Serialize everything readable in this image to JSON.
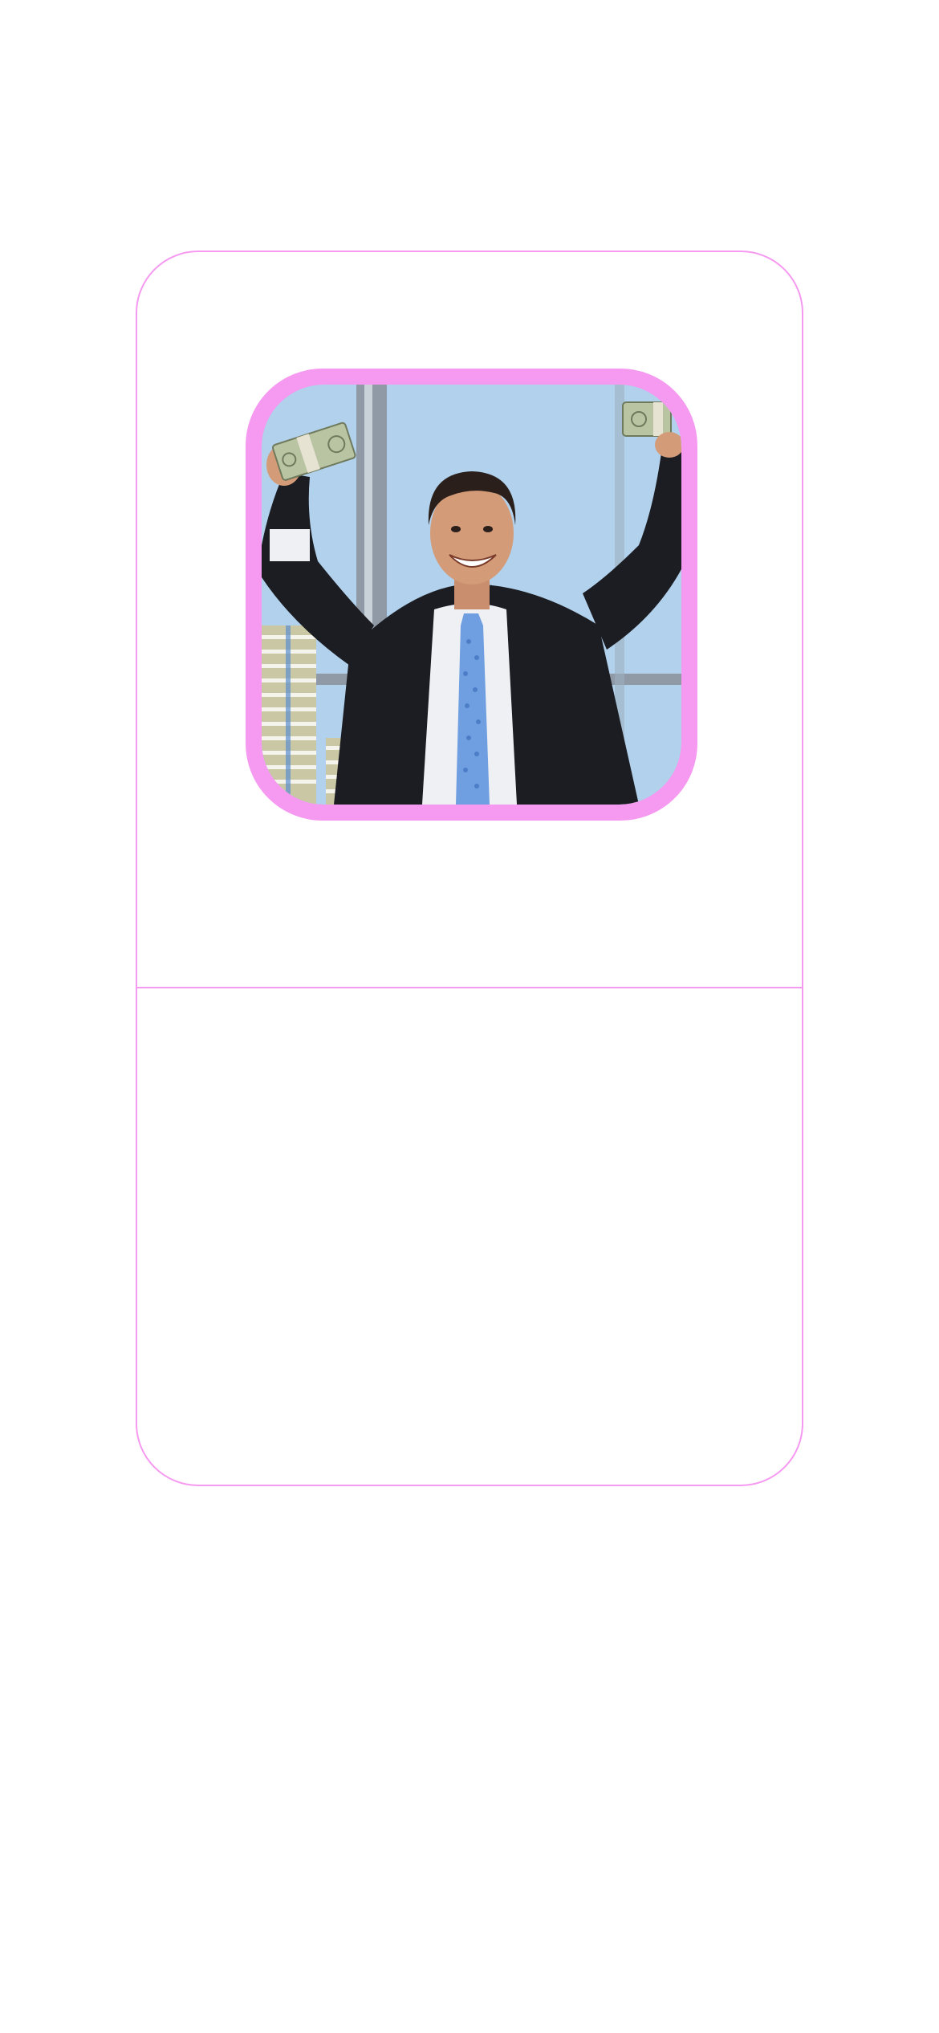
{
  "colors": {
    "accent": "#f59af0",
    "background": "#ffffff"
  },
  "card": {
    "image": {
      "subject": "photo-businessman-celebrating-with-cash"
    }
  }
}
